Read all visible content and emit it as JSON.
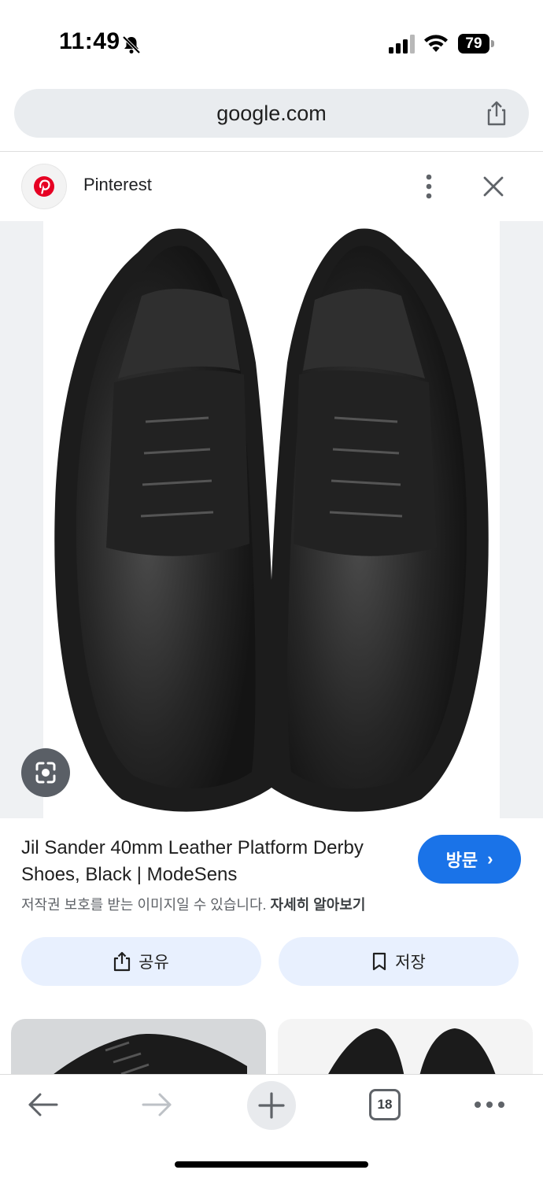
{
  "status_bar": {
    "time": "11:49",
    "battery": "79"
  },
  "browser": {
    "url": "google.com",
    "tab_count": "18"
  },
  "source": {
    "name": "Pinterest"
  },
  "result": {
    "title": "Jil Sander 40mm Leather Platform Derby Shoes, Black | ModeSens",
    "visit_label": "방문",
    "copyright_text": "저작권 보호를 받는 이미지일 수 있습니다.",
    "learn_more": "자세히 알아보기",
    "share_label": "공유",
    "save_label": "저장"
  },
  "icons": [
    "bell-slash-icon",
    "signal-icon",
    "wifi-icon",
    "battery-icon",
    "share-icon",
    "pinterest-logo",
    "more-vert-icon",
    "close-icon",
    "lens-icon",
    "bookmark-icon",
    "back-arrow-icon",
    "forward-arrow-icon",
    "plus-icon",
    "tabs-icon",
    "more-horiz-icon"
  ],
  "colors": {
    "accent": "#1a73e8",
    "pinterest": "#e60023",
    "pill_bg": "#e8f0fe"
  }
}
